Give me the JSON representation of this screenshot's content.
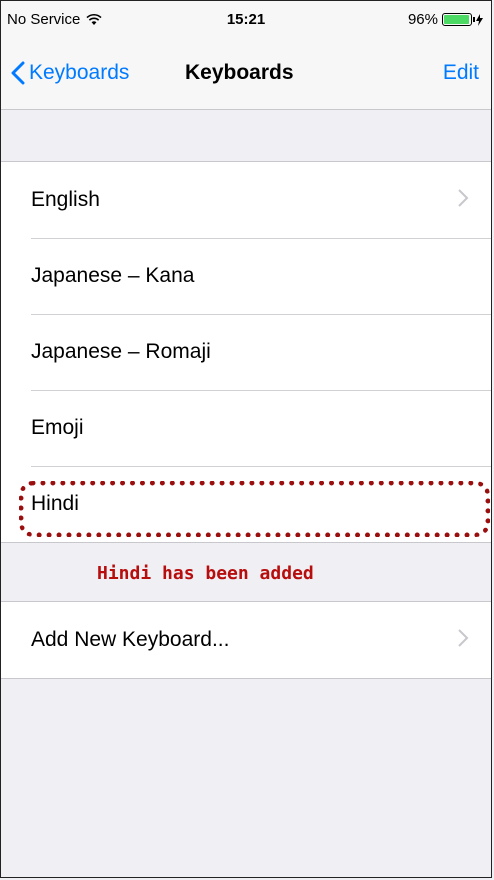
{
  "status_bar": {
    "carrier": "No Service",
    "time": "15:21",
    "battery_percent": "96%",
    "battery_level": 0.96,
    "battery_color": "#4cd964"
  },
  "nav": {
    "back_label": "Keyboards",
    "title": "Keyboards",
    "edit_label": "Edit",
    "accent_color": "#007aff"
  },
  "keyboards": [
    {
      "label": "English"
    },
    {
      "label": "Japanese – Kana"
    },
    {
      "label": "Japanese – Romaji"
    },
    {
      "label": "Emoji"
    },
    {
      "label": "Hindi"
    }
  ],
  "annotation": {
    "text": "Hindi has been added",
    "color": "#b80d0d"
  },
  "add_keyboard": {
    "label": "Add New Keyboard..."
  }
}
